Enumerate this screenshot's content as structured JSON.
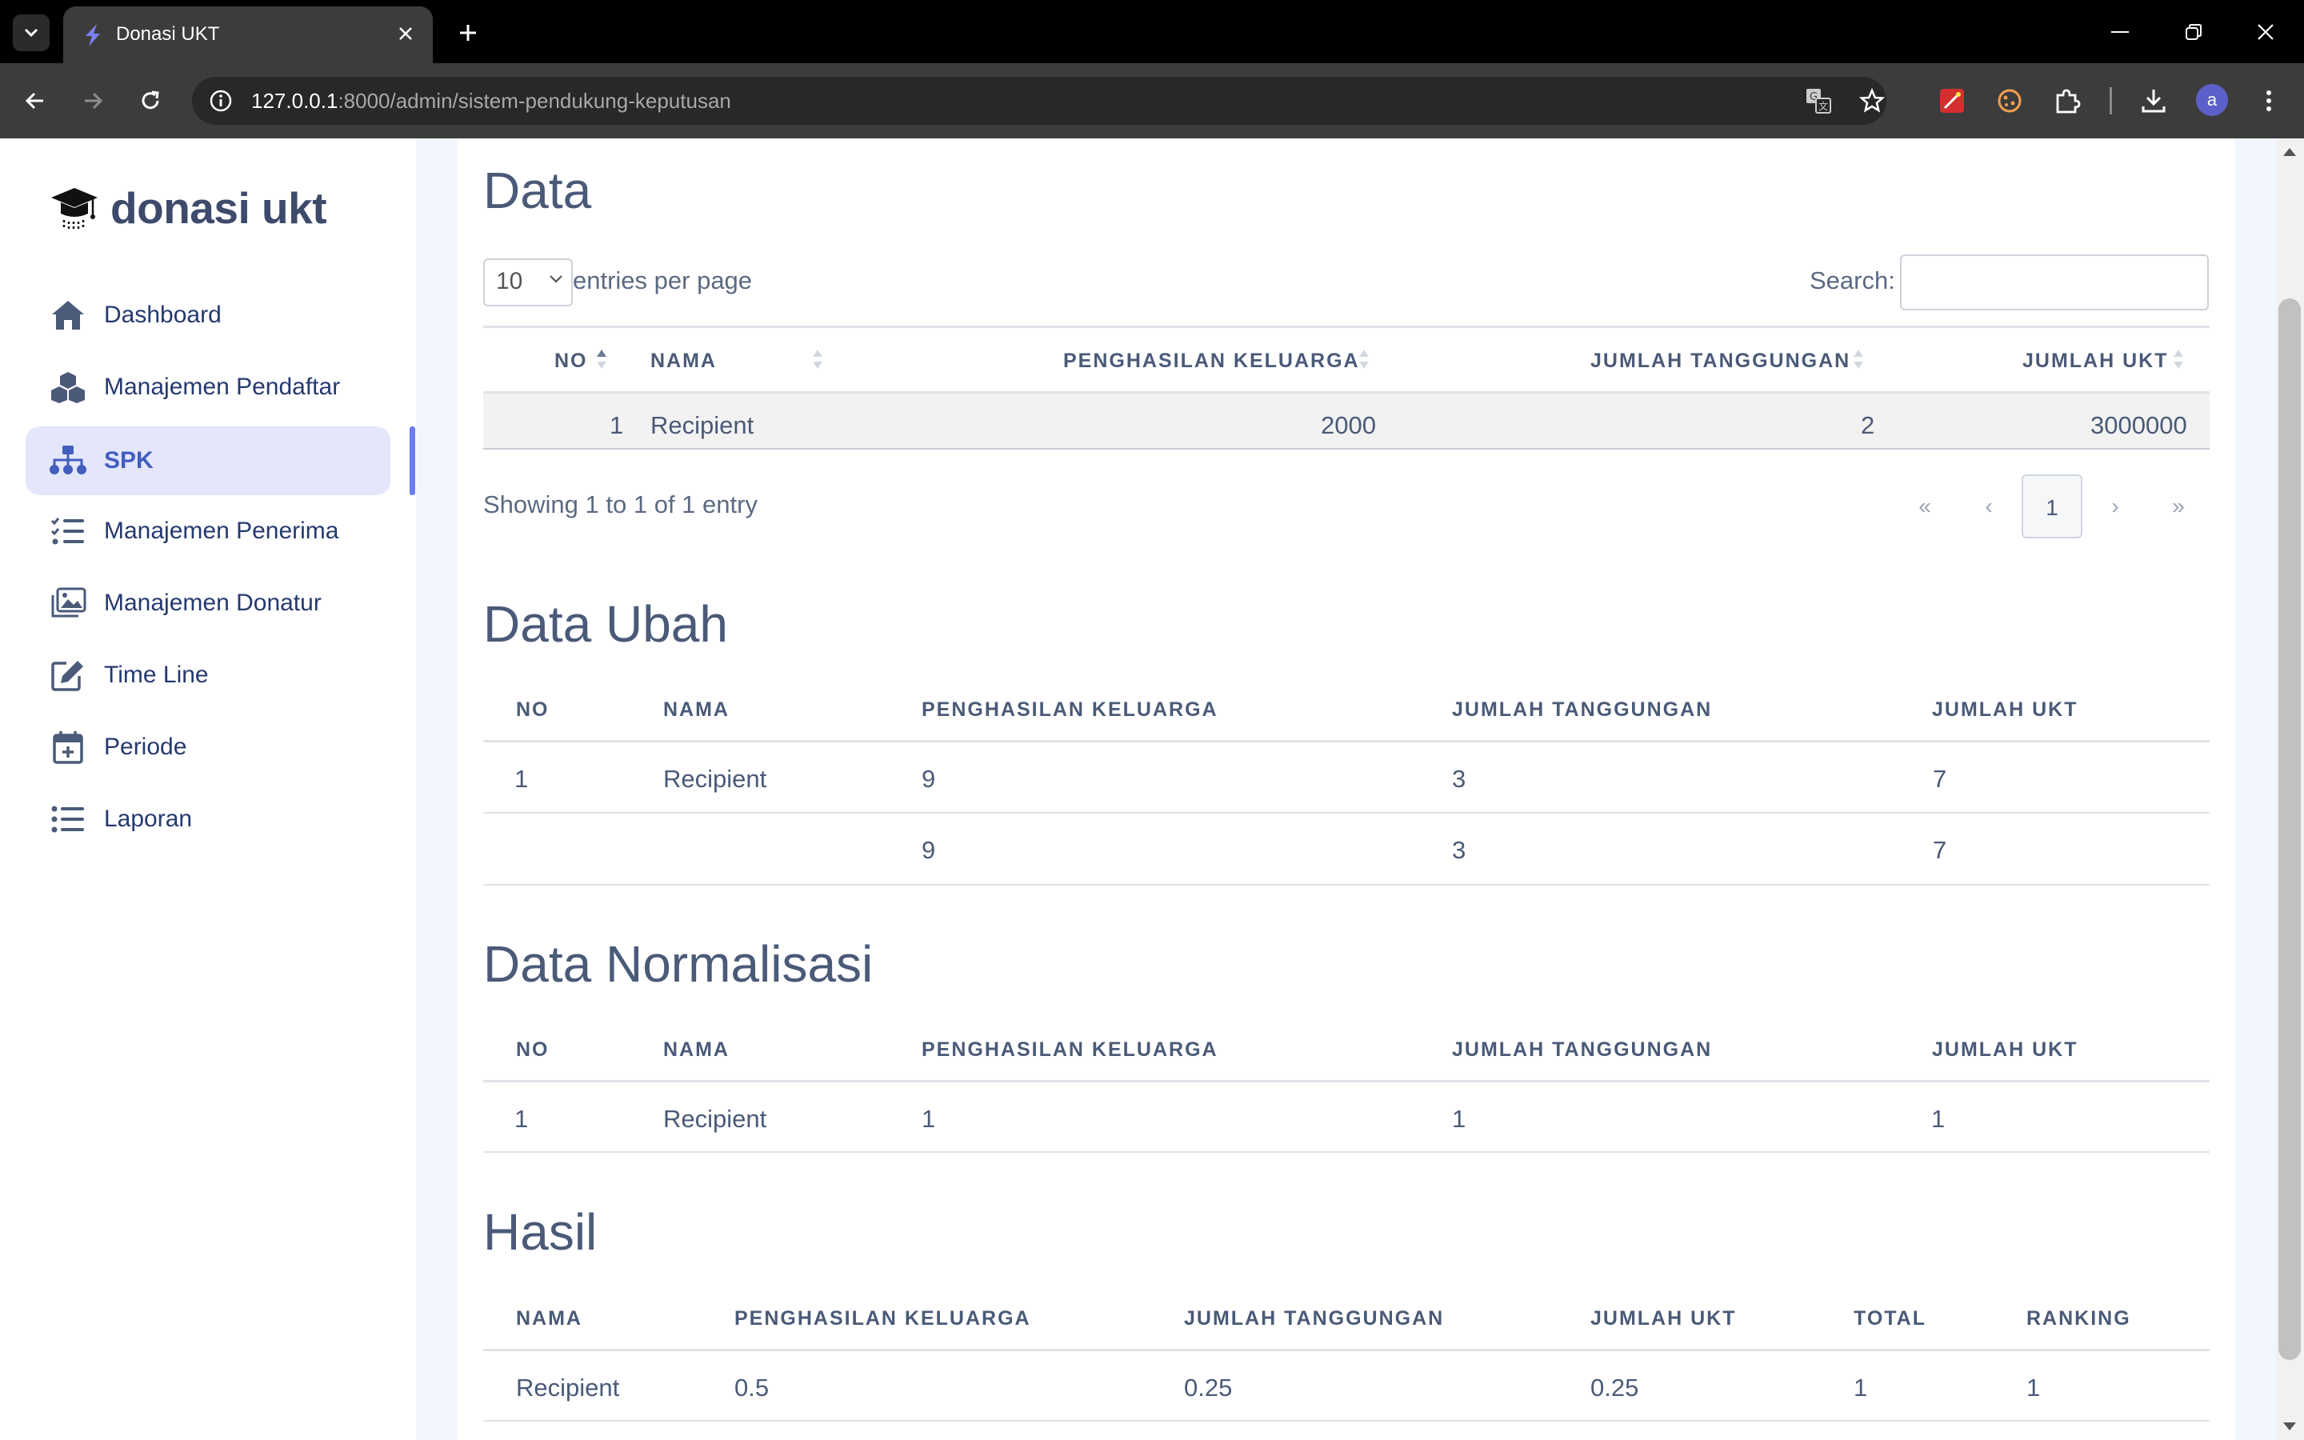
{
  "browser": {
    "tab_title": "Donasi UKT",
    "url_host": "127.0.0.1",
    "url_rest": ":8000/admin/sistem-pendukung-keputusan",
    "profile_initial": "a"
  },
  "sidebar": {
    "brand": "donasi ukt",
    "items": [
      {
        "label": "Dashboard",
        "icon": "house-icon"
      },
      {
        "label": "Manajemen Pendaftar",
        "icon": "cubes-icon"
      },
      {
        "label": "SPK",
        "icon": "sitemap-icon"
      },
      {
        "label": "Manajemen Penerima",
        "icon": "list-check-icon"
      },
      {
        "label": "Manajemen Donatur",
        "icon": "images-icon"
      },
      {
        "label": "Time Line",
        "icon": "edit-icon"
      },
      {
        "label": "Periode",
        "icon": "calendar-plus-icon"
      },
      {
        "label": "Laporan",
        "icon": "list-icon"
      }
    ],
    "active": "SPK"
  },
  "data_section": {
    "title": "Data",
    "entries_value": "10",
    "entries_label": "entries per page",
    "search_label": "Search:",
    "search_value": "",
    "headers": [
      "NO",
      "NAMA",
      "PENGHASILAN KELUARGA",
      "JUMLAH TANGGUNGAN",
      "JUMLAH UKT"
    ],
    "rows": [
      [
        "1",
        "Recipient",
        "2000",
        "2",
        "3000000"
      ]
    ],
    "showing": "Showing 1 to 1 of 1 entry",
    "pagination": {
      "first": "«",
      "prev": "‹",
      "current": "1",
      "next": "›",
      "last": "»"
    }
  },
  "data_ubah": {
    "title": "Data Ubah",
    "headers": [
      "NO",
      "NAMA",
      "PENGHASILAN KELUARGA",
      "JUMLAH TANGGUNGAN",
      "JUMLAH UKT"
    ],
    "rows": [
      [
        "1",
        "Recipient",
        "9",
        "3",
        "7"
      ],
      [
        "",
        "",
        "9",
        "3",
        "7"
      ]
    ]
  },
  "data_normalisasi": {
    "title": "Data Normalisasi",
    "headers": [
      "NO",
      "NAMA",
      "PENGHASILAN KELUARGA",
      "JUMLAH TANGGUNGAN",
      "JUMLAH UKT"
    ],
    "rows": [
      [
        "1",
        "Recipient",
        "1",
        "1",
        "1"
      ]
    ]
  },
  "hasil": {
    "title": "Hasil",
    "headers": [
      "NAMA",
      "PENGHASILAN KELUARGA",
      "JUMLAH TANGGUNGAN",
      "JUMLAH UKT",
      "TOTAL",
      "RANKING"
    ],
    "rows": [
      [
        "Recipient",
        "0.5",
        "0.25",
        "0.25",
        "1",
        "1"
      ]
    ]
  },
  "colors": {
    "accent": "#435ebe",
    "active_bg": "#e4e6fb",
    "text": "#4a5a78"
  }
}
